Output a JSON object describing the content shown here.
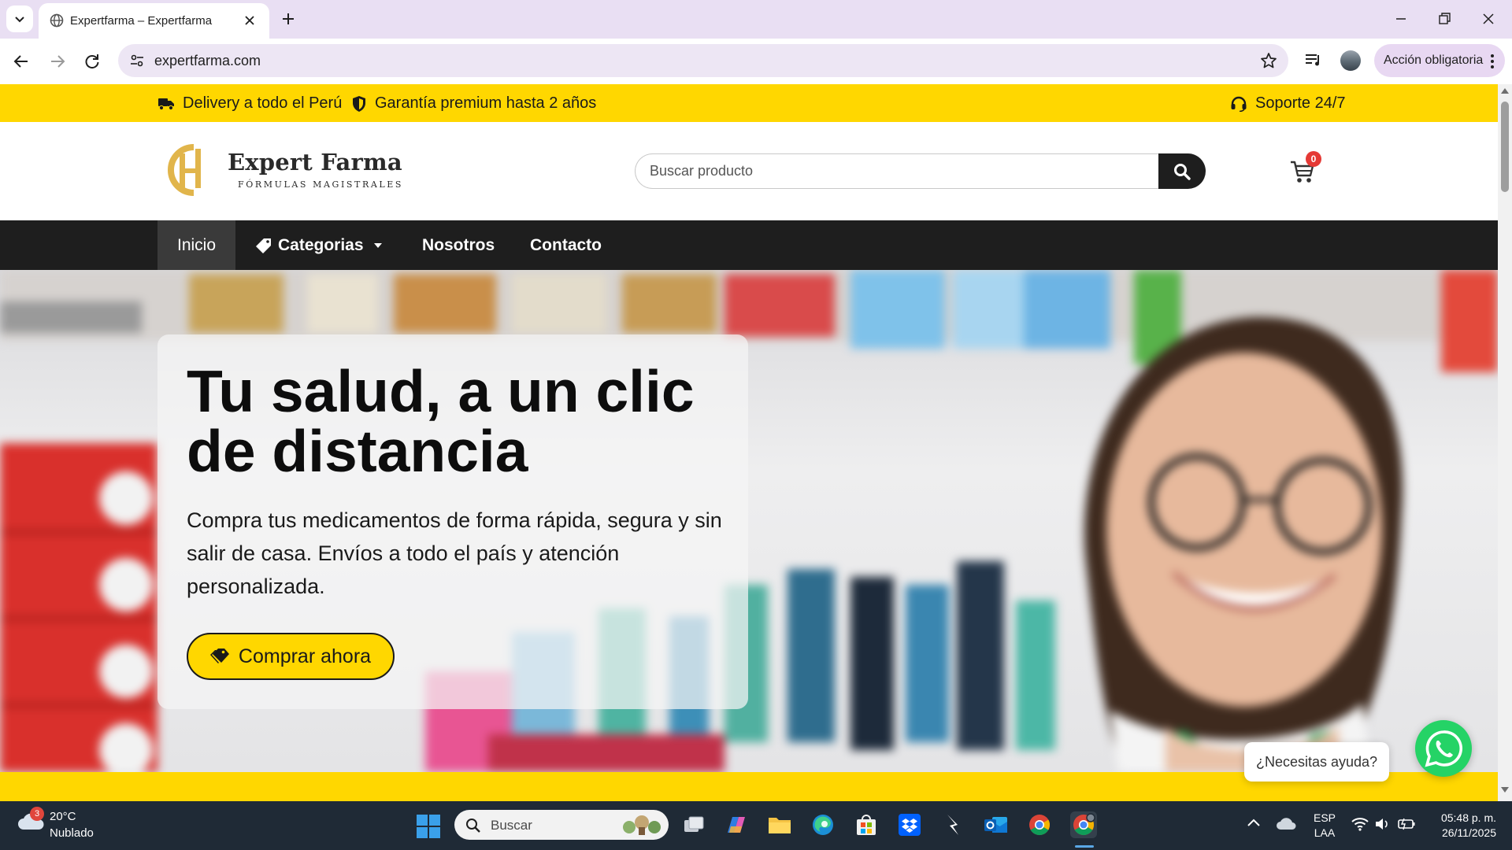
{
  "browser": {
    "tab_title": "Expertfarma – Expertfarma",
    "url": "expertfarma.com",
    "action_label": "Acción obligatoria"
  },
  "topbar": {
    "delivery": "Delivery a todo el Perú",
    "warranty": "Garantía premium hasta 2 años",
    "support": "Soporte 24/7",
    "color": "#ffd700"
  },
  "header": {
    "logo_name": "Expert Farma",
    "logo_sub": "FÓRMULAS MAGISTRALES",
    "search_placeholder": "Buscar producto",
    "cart_count": "0"
  },
  "nav": {
    "items": [
      {
        "label": "Inicio",
        "active": true
      },
      {
        "label": "Categorias",
        "icon": "tag-icon",
        "dropdown": true
      },
      {
        "label": "Nosotros"
      },
      {
        "label": "Contacto"
      }
    ]
  },
  "hero": {
    "title": "Tu salud, a un clic de distancia",
    "text": "Compra tus medicamentos de forma rápida, segura y sin salir de casa. Envíos a todo el país y atención personalizada.",
    "button_label": "Comprar ahora"
  },
  "whatsapp": {
    "help_text": "¿Necesitas ayuda?",
    "color": "#25d366"
  },
  "taskbar": {
    "weather_temp": "20°C",
    "weather_desc": "Nublado",
    "weather_badge": "3",
    "search_label": "Buscar",
    "lang_line1": "ESP",
    "lang_line2": "LAA",
    "time": "05:48 p. m.",
    "date": "26/11/2025"
  }
}
